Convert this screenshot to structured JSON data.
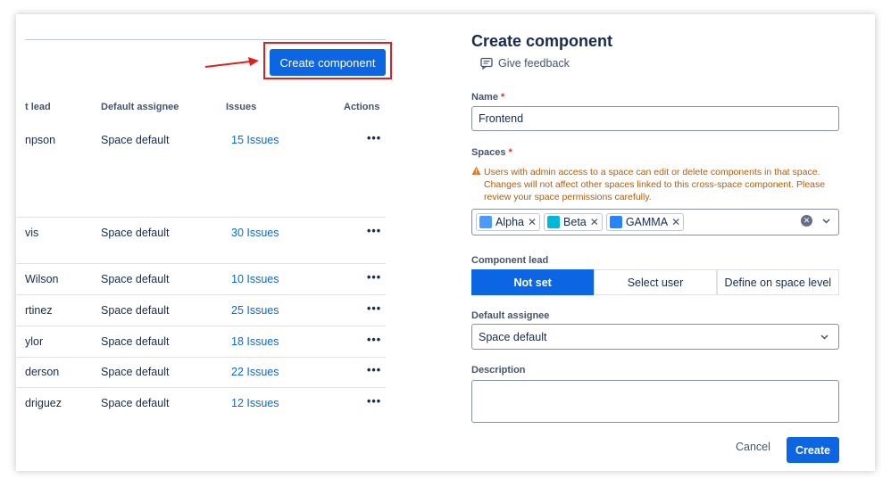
{
  "table": {
    "create_button": "Create component",
    "headers": {
      "lead": "t lead",
      "assignee": "Default assignee",
      "issues": "Issues",
      "actions": "Actions"
    },
    "rows": [
      {
        "lead": "npson",
        "assignee": "Space default",
        "issues": "15 Issues",
        "actions": "•••"
      },
      {
        "lead": "vis",
        "assignee": "Space default",
        "issues": "30 Issues",
        "actions": "•••"
      },
      {
        "lead": "Wilson",
        "assignee": "Space default",
        "issues": "10 Issues",
        "actions": "•••"
      },
      {
        "lead": "rtinez",
        "assignee": "Space default",
        "issues": "25 Issues",
        "actions": "•••"
      },
      {
        "lead": "ylor",
        "assignee": "Space default",
        "issues": "18 Issues",
        "actions": "•••"
      },
      {
        "lead": "derson",
        "assignee": "Space default",
        "issues": "22 Issues",
        "actions": "•••"
      },
      {
        "lead": "driguez",
        "assignee": "Space default",
        "issues": "12 Issues",
        "actions": "•••"
      }
    ]
  },
  "form": {
    "title": "Create component",
    "feedback": "Give feedback",
    "name_label": "Name",
    "name_value": "Frontend",
    "required_mark": "*",
    "spaces_label": "Spaces",
    "spaces_warning": "Users with admin access to a space can edit or delete components in that space. Changes will not affect other spaces linked to this cross-space component. Please review your space permissions carefully.",
    "spaces": [
      {
        "name": "Alpha",
        "color": "#4c9aff"
      },
      {
        "name": "Beta",
        "color": "#00b8d9"
      },
      {
        "name": "GAMMA",
        "color": "#2684ff"
      }
    ],
    "remove_symbol": "✕",
    "clear_symbol": "✕",
    "lead_label": "Component lead",
    "lead_options": [
      "Not set",
      "Select user",
      "Define on space level"
    ],
    "assignee_label": "Default assignee",
    "assignee_value": "Space default",
    "description_label": "Description",
    "cancel": "Cancel",
    "submit": "Create"
  },
  "colors": {
    "primary": "#0c66e4",
    "highlight": "#e01e1e",
    "warning": "#b65c02"
  }
}
